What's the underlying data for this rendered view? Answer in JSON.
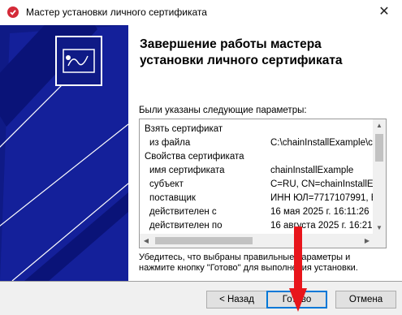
{
  "window": {
    "title": "Мастер установки личного сертификата",
    "close_glyph": "✕",
    "icon": "certificate-app-icon"
  },
  "main": {
    "heading": "Завершение работы мастера установки личного сертификата",
    "intro": "Были указаны следующие параметры:",
    "params": [
      {
        "label": "Взять сертификат",
        "value": "",
        "sub": false
      },
      {
        "label": "из файла",
        "value": "C:\\chainInstallExample\\ce",
        "sub": true
      },
      {
        "label": "Свойства сертификата",
        "value": "",
        "sub": false
      },
      {
        "label": "имя сертификата",
        "value": "chainInstallExample",
        "sub": true
      },
      {
        "label": "субъект",
        "value": "C=RU, CN=chainInstallExample",
        "sub": true
      },
      {
        "label": "поставщик",
        "value": "ИНН ЮЛ=7717107991, E",
        "sub": true
      },
      {
        "label": "действителен с",
        "value": "16 мая 2025 г. 16:11:26",
        "sub": true
      },
      {
        "label": "действителен по",
        "value": "16 августа 2025 г. 16:21:",
        "sub": true
      }
    ],
    "note": "Убедитесь, что выбраны правильные параметры и нажмите кнопку \"Готово\" для выполнения установки."
  },
  "scroll": {
    "up": "▲",
    "down": "▼",
    "left": "◀",
    "right": "▶"
  },
  "footer": {
    "back_label": "< Назад",
    "finish_label": "Готово",
    "cancel_label": "Отмена"
  },
  "colors": {
    "sidebar": "#0f1a86",
    "annotation_arrow": "#e8151b",
    "focus_border": "#0078d7"
  }
}
